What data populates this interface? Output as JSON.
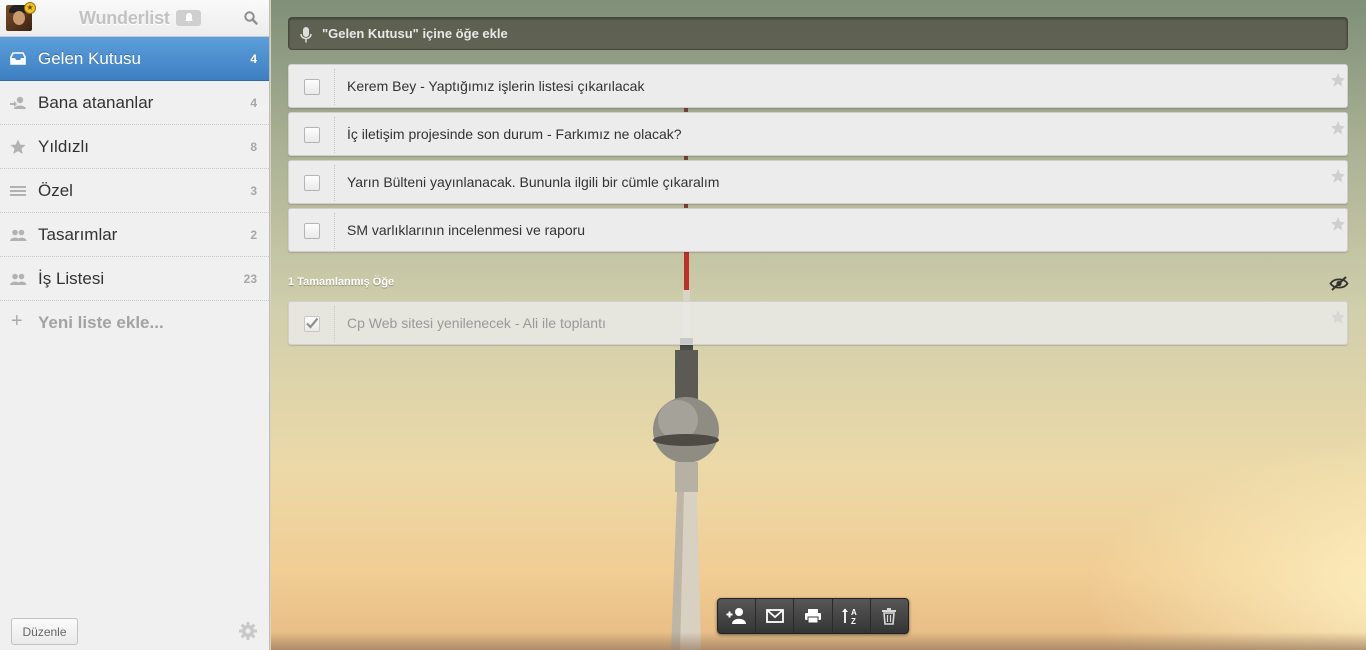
{
  "app": {
    "title": "Wunderlist",
    "badge_icon": "star-badge-icon"
  },
  "sidebar": {
    "items": [
      {
        "label": "Gelen Kutusu",
        "count": "4",
        "icon": "inbox-icon",
        "active": true
      },
      {
        "label": "Bana atananlar",
        "count": "4",
        "icon": "assigned-user-icon"
      },
      {
        "label": "Yıldızlı",
        "count": "8",
        "icon": "star-icon"
      },
      {
        "label": "Özel",
        "count": "3",
        "icon": "list-icon"
      },
      {
        "label": "Tasarımlar",
        "count": "2",
        "icon": "shared-users-icon"
      },
      {
        "label": "İş Listesi",
        "count": "23",
        "icon": "shared-users-icon"
      }
    ],
    "new_list_label": "Yeni liste ekle...",
    "edit_label": "Düzenle"
  },
  "main": {
    "add_placeholder": "\"Gelen Kutusu\" içine öğe ekle",
    "tasks": [
      {
        "text": "Kerem Bey - Yaptığımız işlerin listesi çıkarılacak"
      },
      {
        "text": "İç iletişim projesinde son durum - Farkımız ne olacak?"
      },
      {
        "text": "Yarın Bülteni yayınlanacak. Bununla ilgili bir cümle çıkaralım"
      },
      {
        "text": "SM varlıklarının incelenmesi ve raporu"
      }
    ],
    "completed_label": "1 Tamamlanmış Öğe",
    "completed_tasks": [
      {
        "text": "Cp Web sitesi yenilenecek - Ali ile toplantı"
      }
    ]
  },
  "toolbar": {
    "buttons": [
      {
        "icon": "add-person-icon"
      },
      {
        "icon": "email-icon"
      },
      {
        "icon": "print-icon"
      },
      {
        "icon": "sort-az-icon"
      },
      {
        "icon": "trash-icon"
      }
    ]
  },
  "colors": {
    "accent": "#4a8ccf",
    "sidebar_bg": "#f0f0f0",
    "task_bg": "#ececec"
  }
}
